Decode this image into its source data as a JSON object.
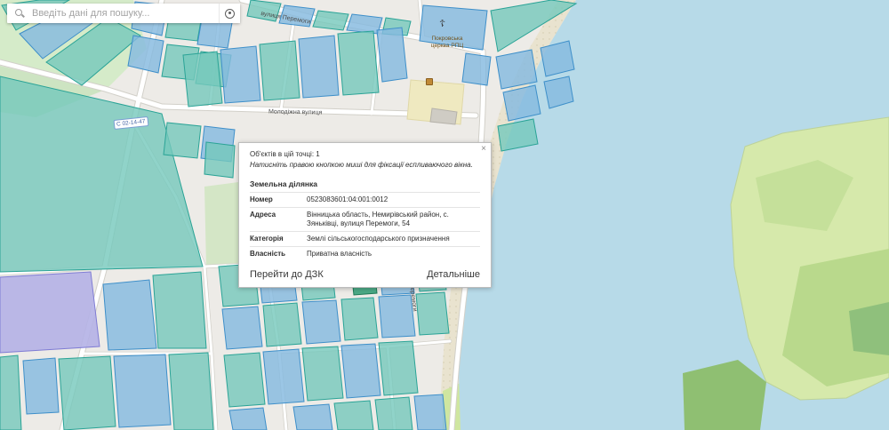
{
  "search": {
    "placeholder": "Введіть дані для пошуку..."
  },
  "popup": {
    "objects_count_line": "Об'єктів в цій точці: 1",
    "hint": "Натисніть правою кнопкою миші для фіксації еспливаючого вікна.",
    "close_label": "×",
    "section_title": "Земельна ділянка",
    "fields": [
      {
        "label": "Номер",
        "value": "0523083601:04:001:0012"
      },
      {
        "label": "Адреса",
        "value": "Вінницька область, Немирівський район, с. Зяньківці, вулиця Перемоги, 54"
      },
      {
        "label": "Категорія",
        "value": "Землі сільськогосподарського призначення"
      },
      {
        "label": "Власність",
        "value": "Приватна власність"
      }
    ],
    "actions": {
      "goto_dzk": "Перейти до ДЗК",
      "details": "Детальніше"
    }
  },
  "map_labels": {
    "street_peremohy": "вулиця Перемоги",
    "street_molodizhna": "Молодіжна вулиця",
    "street_peremohy_south": "вулиця Перемоги",
    "road_shield": "С 02-14-47",
    "church": "Покровська церква РПЦ",
    "church_cross_icon": "☦"
  },
  "colors": {
    "water": "#b7dae8",
    "sand": "#e9e3cf",
    "land": "#edebe7",
    "vegetation": "#d5ebc9",
    "island_green": "#d6e9ab",
    "parcel_teal": "#74c8bc",
    "parcel_blue": "#85badf",
    "parcel_lavender": "#b4b1e6",
    "parcel_dark_green": "#2e9e74"
  }
}
